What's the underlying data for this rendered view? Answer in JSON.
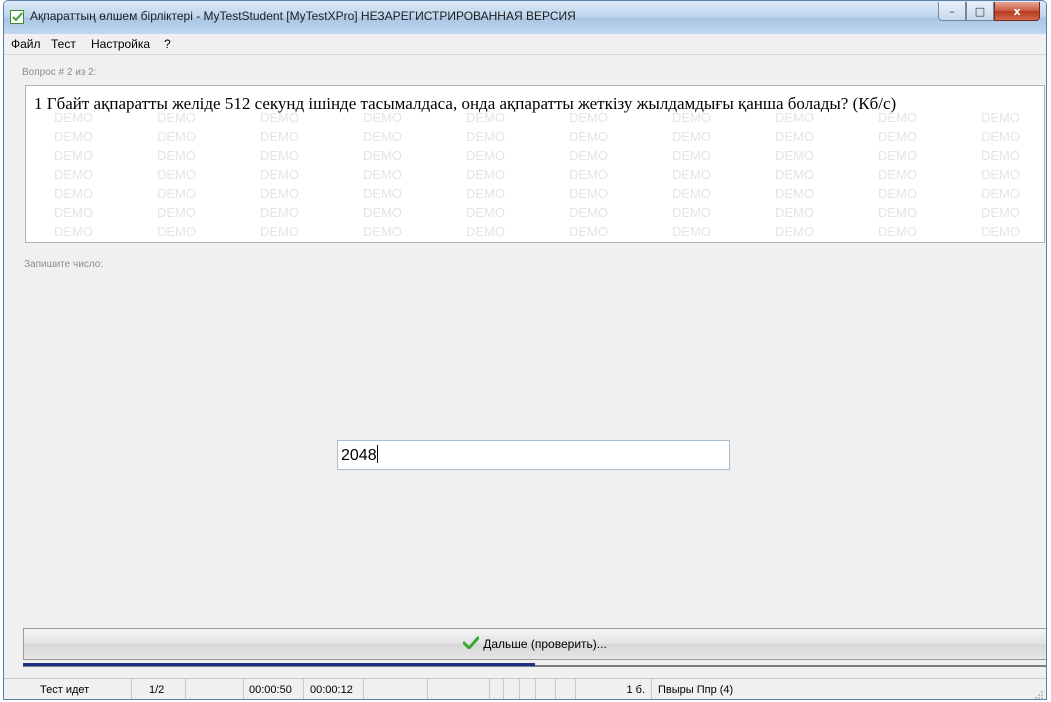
{
  "window": {
    "title": "Ақпараттың өлшем бірліктері - MyTestStudent [MyTestXPro] НЕЗАРЕГИСТРИРОВАННАЯ ВЕРСИЯ",
    "controls": {
      "minimize": "–",
      "maximize": "□",
      "close": "x"
    }
  },
  "menu": [
    "Файл",
    "Тест",
    "Настройка",
    "?"
  ],
  "question": {
    "label": "Вопрос # 2 из 2:",
    "text": "1 Гбайт ақпаратты желіде  512 секунд ішінде  тасымалдаса, онда ақпаратты жеткізу  жылдамдығы қанша болады? (Кб/с)",
    "watermark": "DEMO"
  },
  "answer": {
    "label": "Запишите число:",
    "value": "2048"
  },
  "next_button": {
    "label": "Дальше (проверить)..."
  },
  "progress": {
    "fraction": 0.5,
    "color": "#1c2f8a"
  },
  "status": {
    "state": "Тест идет",
    "question_counter": "1/2",
    "time_elapsed": "00:00:50",
    "time_question": "00:00:12",
    "score": "1 б.",
    "user": "Пвыры Ппр (4)"
  },
  "colors": {
    "titlebar": "#bcd3ec",
    "check_green": "#3aa62f"
  }
}
